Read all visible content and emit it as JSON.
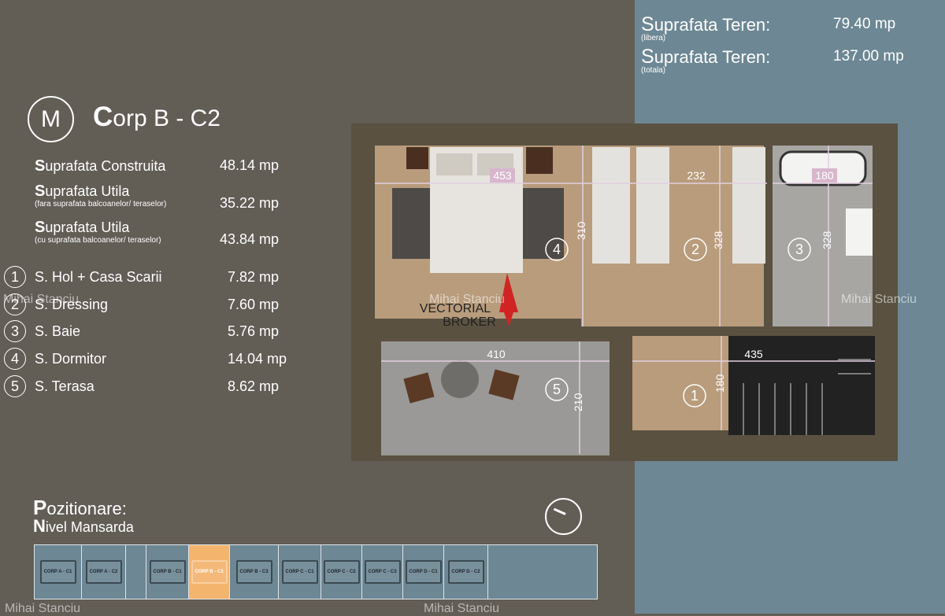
{
  "terrain": {
    "rows": [
      {
        "cap": "S",
        "label": "uprafata Teren:",
        "note": "(libera)",
        "value": "79.40 mp"
      },
      {
        "cap": "S",
        "label": "uprafata Teren:",
        "note": "(totala)",
        "value": "137.00 mp"
      }
    ]
  },
  "header": {
    "logo_letter": "M",
    "title_cap": "C",
    "title_rest": "orp B - C2"
  },
  "areas": [
    {
      "cap": "S",
      "label": "uprafata Construita",
      "sub": "",
      "value": "48.14 mp"
    },
    {
      "cap": "S",
      "label": "uprafata Utila",
      "sub": "(fara suprafata balcoanelor/ teraselor)",
      "value": "35.22 mp"
    },
    {
      "cap": "S",
      "label": "uprafata Utila",
      "sub": "(cu suprafata balcoanelor/ teraselor)",
      "value": "43.84 mp"
    }
  ],
  "rooms": [
    {
      "num": "1",
      "label": "S. Hol + Casa Scarii",
      "value": "7.82 mp"
    },
    {
      "num": "2",
      "label": "S. Dressing",
      "value": "7.60 mp"
    },
    {
      "num": "3",
      "label": "S. Baie",
      "value": "5.76 mp"
    },
    {
      "num": "4",
      "label": "S. Dormitor",
      "value": "14.04 mp"
    },
    {
      "num": "5",
      "label": "S. Terasa",
      "value": "8.62 mp"
    }
  ],
  "plan": {
    "dimensions": [
      "453",
      "232",
      "180",
      "310",
      "328",
      "328",
      "410",
      "435",
      "210",
      "180"
    ],
    "room_numbers": [
      "4",
      "2",
      "3",
      "5",
      "1"
    ],
    "watermark_broker": [
      "VECTORIAL",
      "BROKER"
    ]
  },
  "watermarks": [
    "Mihai Stanciu",
    "Mihai Stanciu",
    "Mihai Stanciu",
    "Mihai Stanciu",
    "Mihai Stanciu"
  ],
  "position": {
    "title_cap": "P",
    "title_rest": "ozitionare:",
    "sub_cap": "N",
    "sub_rest": "ivel Mansarda",
    "cells": [
      {
        "label": "CORP A - C1",
        "active": false
      },
      {
        "label": "CORP A - C2",
        "active": false
      },
      {
        "label": "",
        "active": false,
        "spacer": true
      },
      {
        "label": "CORP B - C1",
        "active": false
      },
      {
        "label": "CORP B - C2",
        "active": true
      },
      {
        "label": "CORP B - C3",
        "active": false
      },
      {
        "label": "CORP C - C1",
        "active": false
      },
      {
        "label": "CORP C - C2",
        "active": false
      },
      {
        "label": "CORP C - C3",
        "active": false
      },
      {
        "label": "CORP D - C1",
        "active": false
      },
      {
        "label": "CORP D - C2",
        "active": false
      },
      {
        "label": "",
        "active": false,
        "spacer": true
      }
    ]
  },
  "colors": {
    "background": "#625d55",
    "panel_blue": "#6d8794",
    "active_cell": "#f3b46e",
    "dimension_line": "#e2cfe0",
    "wood_floor": "#b89c7c"
  }
}
